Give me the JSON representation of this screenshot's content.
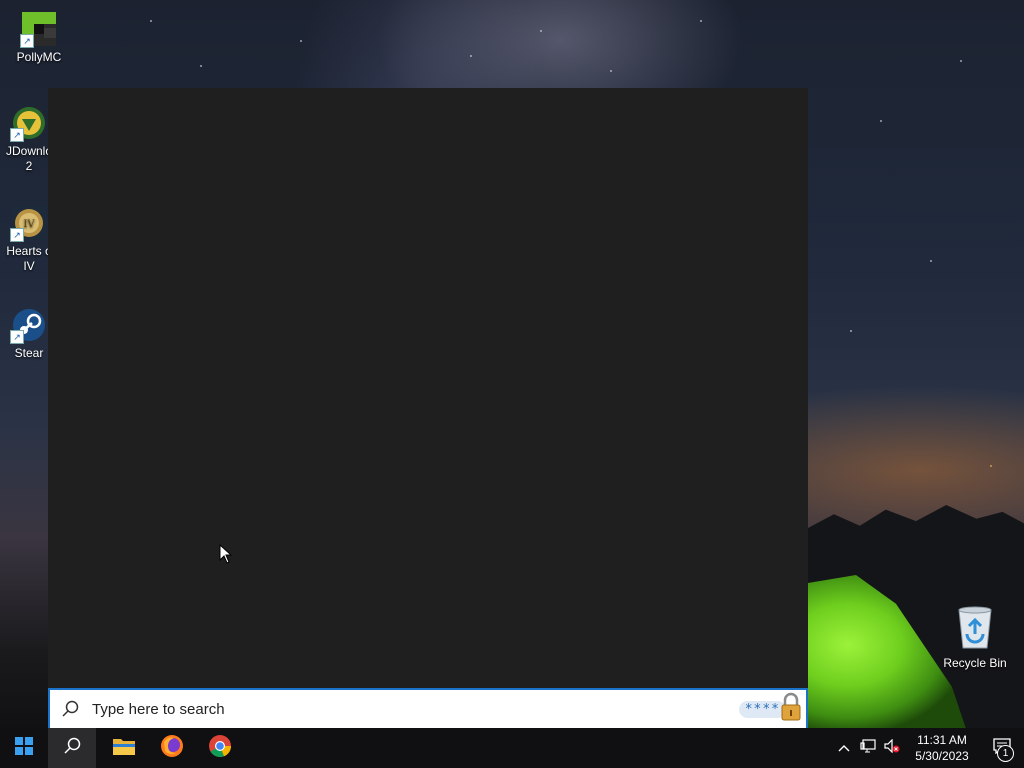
{
  "desktop": {
    "icons": [
      {
        "label_line1": "PollyMC",
        "label_line2": "",
        "icon": "pollymc-icon"
      },
      {
        "label_line1": "JDownlo",
        "label_line2": "2",
        "icon": "jdownloader-icon"
      },
      {
        "label_line1": "Hearts o",
        "label_line2": "IV",
        "icon": "hearts-of-iron-icon"
      },
      {
        "label_line1": "Stear",
        "label_line2": "",
        "icon": "steam-icon"
      }
    ],
    "recycle_bin": {
      "label": "Recycle Bin",
      "icon": "recycle-bin-icon"
    }
  },
  "search": {
    "placeholder": "Type here to search",
    "badge_text": "****",
    "icon": "search-icon",
    "lock_icon": "lock-icon"
  },
  "taskbar": {
    "start_icon": "windows-start-icon",
    "search_icon": "search-icon",
    "pinned": [
      {
        "name": "file-explorer",
        "icon": "folder-icon"
      },
      {
        "name": "firefox",
        "icon": "firefox-icon"
      },
      {
        "name": "chrome",
        "icon": "chrome-icon"
      }
    ],
    "tray": {
      "time": "11:31 AM",
      "date": "5/30/2023",
      "notification_count": "1"
    }
  },
  "colors": {
    "accent": "#1a73c8",
    "flyout_bg": "#1f1f1f",
    "taskbar_bg": "#101012"
  }
}
